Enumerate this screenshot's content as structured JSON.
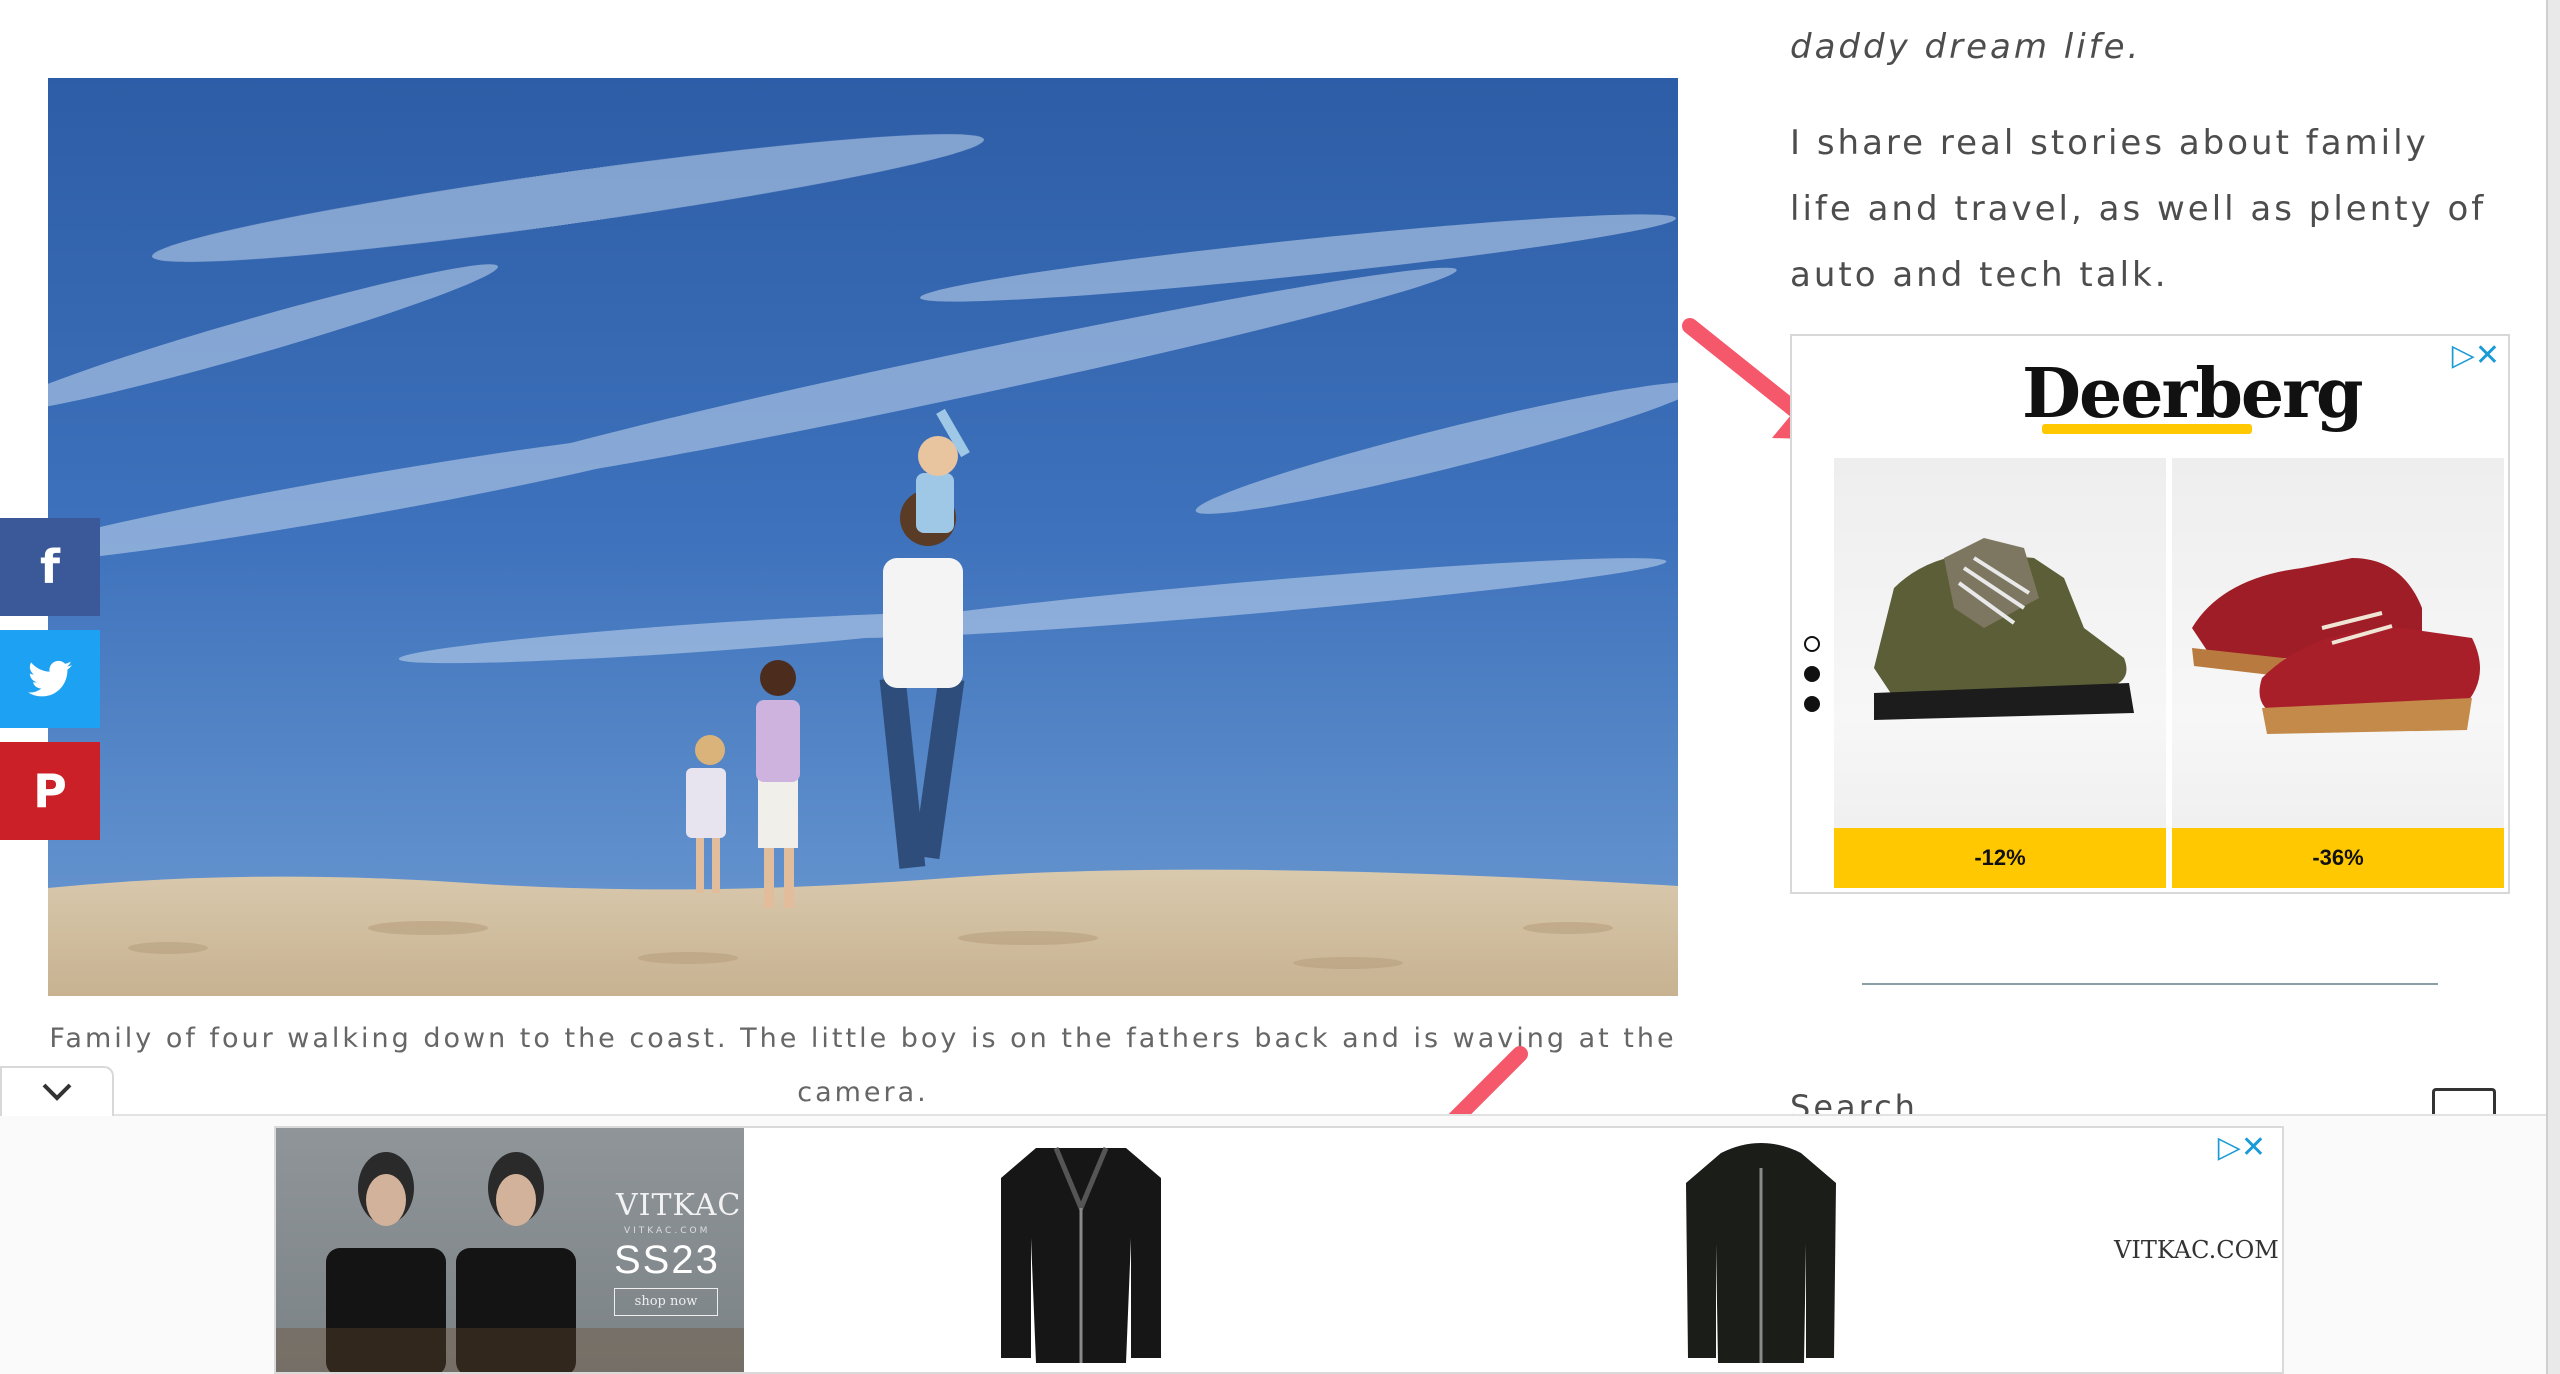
{
  "sidebar": {
    "intro_italic": "daddy dream life.",
    "intro_body": "I share real stories about family life and travel, as well as plenty of auto and tech talk.",
    "search_label": "Search"
  },
  "hero": {
    "caption": "Family of four walking down to the coast. The little boy is on the fathers back and is waving at the camera."
  },
  "ad_side": {
    "brand": "Deerberg",
    "adchoices": "▷✕",
    "products": [
      {
        "name": "hiking boot",
        "discount": "-12%"
      },
      {
        "name": "red felt shoe",
        "discount": "-36%"
      }
    ],
    "brand_color": "#ffc800"
  },
  "ad_bottom": {
    "logo": "VITKAC",
    "logo_sub": "VITKAC.COM",
    "season": "SS23",
    "cta": "shop now",
    "url_text": "VITKAC.COM",
    "adchoices": "▷✕"
  },
  "share": {
    "facebook": "f",
    "twitter": "twitter-bird-icon",
    "pinterest": "P"
  },
  "sticky_toggle": "chevron-down-icon",
  "colors": {
    "facebook": "#3b5998",
    "twitter": "#1da1f2",
    "pinterest": "#cb2027",
    "arrow": "#f4586a"
  }
}
